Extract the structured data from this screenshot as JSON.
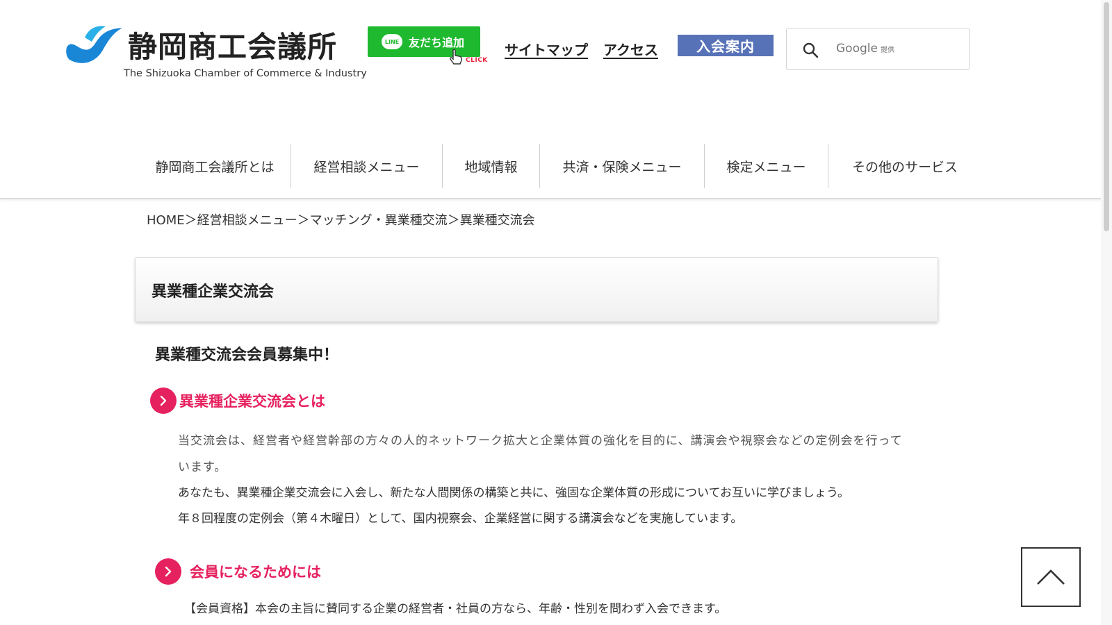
{
  "header": {
    "logo_title": "静岡商工会議所",
    "logo_subtitle": "The Shizuoka Chamber of Commerce & Industry",
    "line_button": {
      "badge": "LINE",
      "label": "友だち追加",
      "click_note": "CLICK"
    },
    "links": {
      "sitemap": "サイトマップ",
      "access": "アクセス"
    },
    "join_button": "入会案内",
    "search": {
      "brand": "Google",
      "brand_note": "提供"
    }
  },
  "nav": {
    "items": [
      {
        "label": "静岡商工会議所とは"
      },
      {
        "label": "経営相談メニュー"
      },
      {
        "label": "地域情報"
      },
      {
        "label": "共済・保険メニュー"
      },
      {
        "label": "検定メニュー"
      },
      {
        "label": "その他のサービス"
      }
    ]
  },
  "breadcrumb": {
    "items": [
      "HOME",
      "経営相談メニュー",
      "マッチング・異業種交流",
      "異業種交流会"
    ],
    "separator": "＞"
  },
  "page": {
    "title": "異業種企業交流会",
    "recruit_heading": "異業種交流会会員募集中！",
    "sections": [
      {
        "title": "異業種企業交流会とは",
        "paragraphs": [
          "当交流会は、経営者や経営幹部の方々の人的ネットワーク拡大と企業体質の強化を目的に、講演会や視察会などの定例会を行って",
          "います。",
          "あなたも、異業種企業交流会に入会し、新たな人間関係の構築と共に、強固な企業体質の形成についてお互いに学びましょう。",
          "年８回程度の定例会（第４木曜日）として、国内視察会、企業経営に関する講演会などを実施しています。"
        ]
      },
      {
        "title": "会員になるためには",
        "paragraphs": [
          "【会員資格】本会の主旨に賛同する企業の経営者・社員の方なら、年齢・性別を問わず入会できます。"
        ]
      }
    ]
  },
  "colors": {
    "accent": "#e6215f",
    "line_green": "#1fb92f",
    "join_blue": "#5872b8"
  },
  "icons": [
    "logo-wave-icon",
    "hand-pointer-icon",
    "search-icon",
    "chevron-right-icon",
    "chevron-up-icon"
  ]
}
